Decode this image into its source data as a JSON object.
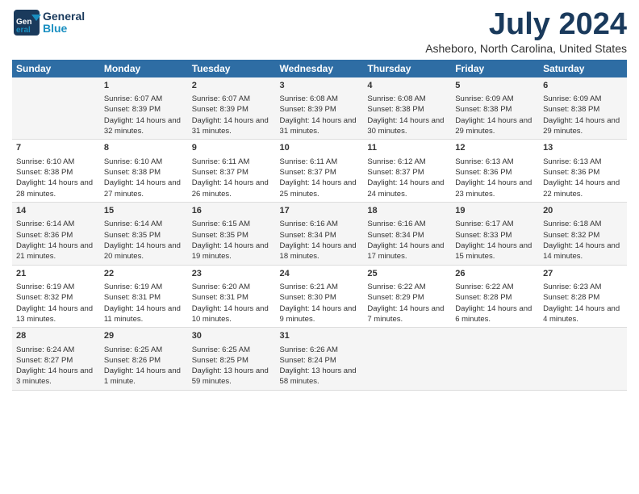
{
  "header": {
    "logo_general": "General",
    "logo_blue": "Blue",
    "main_title": "July 2024",
    "subtitle": "Asheboro, North Carolina, United States"
  },
  "days_of_week": [
    "Sunday",
    "Monday",
    "Tuesday",
    "Wednesday",
    "Thursday",
    "Friday",
    "Saturday"
  ],
  "weeks": [
    [
      {
        "day": "",
        "sunrise": "",
        "sunset": "",
        "daylight": ""
      },
      {
        "day": "1",
        "sunrise": "Sunrise: 6:07 AM",
        "sunset": "Sunset: 8:39 PM",
        "daylight": "Daylight: 14 hours and 32 minutes."
      },
      {
        "day": "2",
        "sunrise": "Sunrise: 6:07 AM",
        "sunset": "Sunset: 8:39 PM",
        "daylight": "Daylight: 14 hours and 31 minutes."
      },
      {
        "day": "3",
        "sunrise": "Sunrise: 6:08 AM",
        "sunset": "Sunset: 8:39 PM",
        "daylight": "Daylight: 14 hours and 31 minutes."
      },
      {
        "day": "4",
        "sunrise": "Sunrise: 6:08 AM",
        "sunset": "Sunset: 8:38 PM",
        "daylight": "Daylight: 14 hours and 30 minutes."
      },
      {
        "day": "5",
        "sunrise": "Sunrise: 6:09 AM",
        "sunset": "Sunset: 8:38 PM",
        "daylight": "Daylight: 14 hours and 29 minutes."
      },
      {
        "day": "6",
        "sunrise": "Sunrise: 6:09 AM",
        "sunset": "Sunset: 8:38 PM",
        "daylight": "Daylight: 14 hours and 29 minutes."
      }
    ],
    [
      {
        "day": "7",
        "sunrise": "Sunrise: 6:10 AM",
        "sunset": "Sunset: 8:38 PM",
        "daylight": "Daylight: 14 hours and 28 minutes."
      },
      {
        "day": "8",
        "sunrise": "Sunrise: 6:10 AM",
        "sunset": "Sunset: 8:38 PM",
        "daylight": "Daylight: 14 hours and 27 minutes."
      },
      {
        "day": "9",
        "sunrise": "Sunrise: 6:11 AM",
        "sunset": "Sunset: 8:37 PM",
        "daylight": "Daylight: 14 hours and 26 minutes."
      },
      {
        "day": "10",
        "sunrise": "Sunrise: 6:11 AM",
        "sunset": "Sunset: 8:37 PM",
        "daylight": "Daylight: 14 hours and 25 minutes."
      },
      {
        "day": "11",
        "sunrise": "Sunrise: 6:12 AM",
        "sunset": "Sunset: 8:37 PM",
        "daylight": "Daylight: 14 hours and 24 minutes."
      },
      {
        "day": "12",
        "sunrise": "Sunrise: 6:13 AM",
        "sunset": "Sunset: 8:36 PM",
        "daylight": "Daylight: 14 hours and 23 minutes."
      },
      {
        "day": "13",
        "sunrise": "Sunrise: 6:13 AM",
        "sunset": "Sunset: 8:36 PM",
        "daylight": "Daylight: 14 hours and 22 minutes."
      }
    ],
    [
      {
        "day": "14",
        "sunrise": "Sunrise: 6:14 AM",
        "sunset": "Sunset: 8:36 PM",
        "daylight": "Daylight: 14 hours and 21 minutes."
      },
      {
        "day": "15",
        "sunrise": "Sunrise: 6:14 AM",
        "sunset": "Sunset: 8:35 PM",
        "daylight": "Daylight: 14 hours and 20 minutes."
      },
      {
        "day": "16",
        "sunrise": "Sunrise: 6:15 AM",
        "sunset": "Sunset: 8:35 PM",
        "daylight": "Daylight: 14 hours and 19 minutes."
      },
      {
        "day": "17",
        "sunrise": "Sunrise: 6:16 AM",
        "sunset": "Sunset: 8:34 PM",
        "daylight": "Daylight: 14 hours and 18 minutes."
      },
      {
        "day": "18",
        "sunrise": "Sunrise: 6:16 AM",
        "sunset": "Sunset: 8:34 PM",
        "daylight": "Daylight: 14 hours and 17 minutes."
      },
      {
        "day": "19",
        "sunrise": "Sunrise: 6:17 AM",
        "sunset": "Sunset: 8:33 PM",
        "daylight": "Daylight: 14 hours and 15 minutes."
      },
      {
        "day": "20",
        "sunrise": "Sunrise: 6:18 AM",
        "sunset": "Sunset: 8:32 PM",
        "daylight": "Daylight: 14 hours and 14 minutes."
      }
    ],
    [
      {
        "day": "21",
        "sunrise": "Sunrise: 6:19 AM",
        "sunset": "Sunset: 8:32 PM",
        "daylight": "Daylight: 14 hours and 13 minutes."
      },
      {
        "day": "22",
        "sunrise": "Sunrise: 6:19 AM",
        "sunset": "Sunset: 8:31 PM",
        "daylight": "Daylight: 14 hours and 11 minutes."
      },
      {
        "day": "23",
        "sunrise": "Sunrise: 6:20 AM",
        "sunset": "Sunset: 8:31 PM",
        "daylight": "Daylight: 14 hours and 10 minutes."
      },
      {
        "day": "24",
        "sunrise": "Sunrise: 6:21 AM",
        "sunset": "Sunset: 8:30 PM",
        "daylight": "Daylight: 14 hours and 9 minutes."
      },
      {
        "day": "25",
        "sunrise": "Sunrise: 6:22 AM",
        "sunset": "Sunset: 8:29 PM",
        "daylight": "Daylight: 14 hours and 7 minutes."
      },
      {
        "day": "26",
        "sunrise": "Sunrise: 6:22 AM",
        "sunset": "Sunset: 8:28 PM",
        "daylight": "Daylight: 14 hours and 6 minutes."
      },
      {
        "day": "27",
        "sunrise": "Sunrise: 6:23 AM",
        "sunset": "Sunset: 8:28 PM",
        "daylight": "Daylight: 14 hours and 4 minutes."
      }
    ],
    [
      {
        "day": "28",
        "sunrise": "Sunrise: 6:24 AM",
        "sunset": "Sunset: 8:27 PM",
        "daylight": "Daylight: 14 hours and 3 minutes."
      },
      {
        "day": "29",
        "sunrise": "Sunrise: 6:25 AM",
        "sunset": "Sunset: 8:26 PM",
        "daylight": "Daylight: 14 hours and 1 minute."
      },
      {
        "day": "30",
        "sunrise": "Sunrise: 6:25 AM",
        "sunset": "Sunset: 8:25 PM",
        "daylight": "Daylight: 13 hours and 59 minutes."
      },
      {
        "day": "31",
        "sunrise": "Sunrise: 6:26 AM",
        "sunset": "Sunset: 8:24 PM",
        "daylight": "Daylight: 13 hours and 58 minutes."
      },
      {
        "day": "",
        "sunrise": "",
        "sunset": "",
        "daylight": ""
      },
      {
        "day": "",
        "sunrise": "",
        "sunset": "",
        "daylight": ""
      },
      {
        "day": "",
        "sunrise": "",
        "sunset": "",
        "daylight": ""
      }
    ]
  ]
}
